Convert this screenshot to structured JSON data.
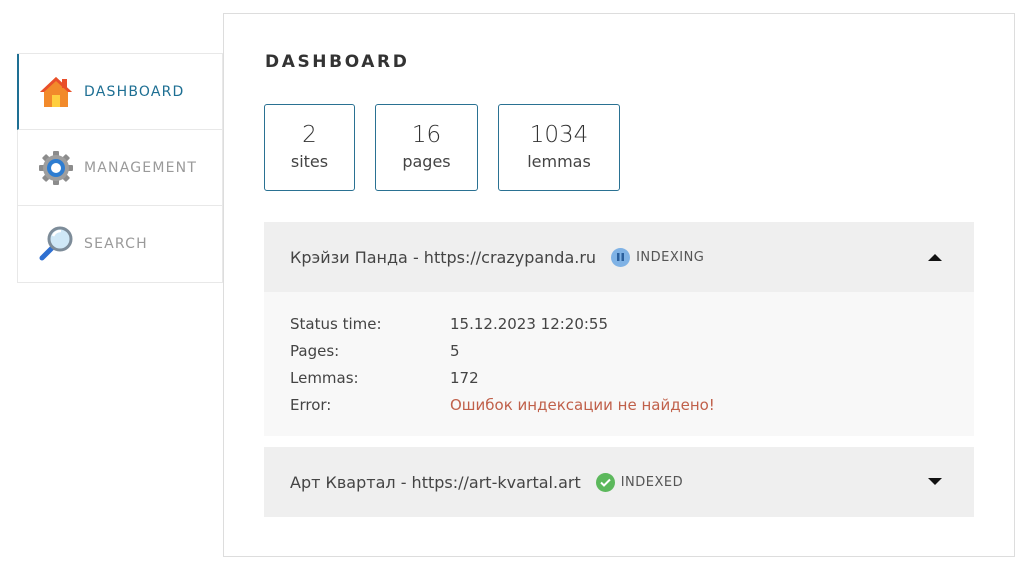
{
  "sidebar": {
    "items": [
      {
        "label": "DASHBOARD",
        "icon": "home-icon",
        "active": true
      },
      {
        "label": "MANAGEMENT",
        "icon": "gear-icon",
        "active": false
      },
      {
        "label": "SEARCH",
        "icon": "magnifier-icon",
        "active": false
      }
    ]
  },
  "main": {
    "title": "DASHBOARD",
    "stats": [
      {
        "value": "2",
        "label": "sites"
      },
      {
        "value": "16",
        "label": "pages"
      },
      {
        "value": "1034",
        "label": "lemmas"
      }
    ],
    "sites": [
      {
        "name": "Крэйзи Панда - https://crazypanda.ru",
        "status": "INDEXING",
        "status_icon": "pause-icon",
        "expanded": true,
        "details": {
          "status_time_label": "Status time:",
          "status_time": "15.12.2023 12:20:55",
          "pages_label": "Pages:",
          "pages": "5",
          "lemmas_label": "Lemmas:",
          "lemmas": "172",
          "error_label": "Error:",
          "error": "Ошибок индексации не найдено!"
        }
      },
      {
        "name": "Арт Квартал - https://art-kvartal.art",
        "status": "INDEXED",
        "status_icon": "check-icon",
        "expanded": false
      }
    ]
  },
  "colors": {
    "accent": "#1e6f93",
    "indexing": "#7fb2e5",
    "indexed": "#5cb85c",
    "error": "#c0604a"
  }
}
